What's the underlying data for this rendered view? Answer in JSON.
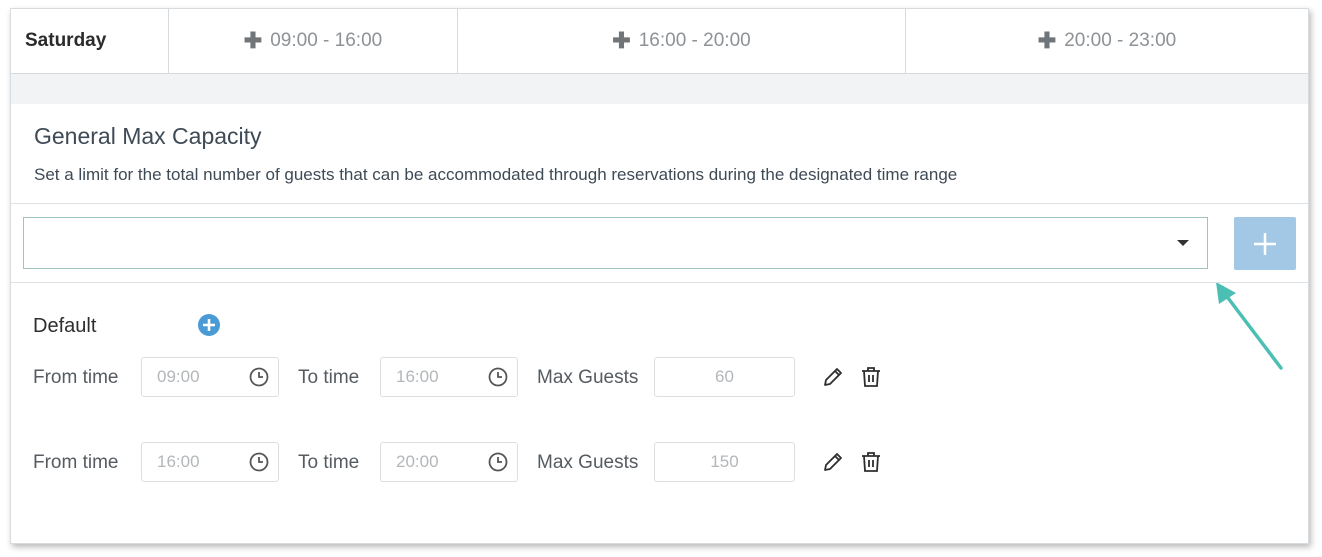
{
  "schedule": {
    "day": "Saturday",
    "slots": [
      "09:00 - 16:00",
      "16:00 - 20:00",
      "20:00 - 23:00"
    ]
  },
  "capacity": {
    "title": "General Max Capacity",
    "description": "Set a limit for the total number of guests that can be accommodated through reservations during the designated time range",
    "select_value": ""
  },
  "default_group": {
    "label": "Default",
    "from_label": "From time",
    "to_label": "To time",
    "max_label": "Max Guests",
    "rows": [
      {
        "from": "09:00",
        "to": "16:00",
        "max": "60"
      },
      {
        "from": "16:00",
        "to": "20:00",
        "max": "150"
      }
    ]
  },
  "colors": {
    "accent": "#4a9ad6",
    "add_button": "#a3c8e6",
    "arrow": "#4bbfb4"
  },
  "icons": [
    "plus-icon",
    "chevron-down-icon",
    "plus-circle-icon",
    "clock-icon",
    "pencil-icon",
    "trash-icon",
    "arrow-annotation"
  ]
}
